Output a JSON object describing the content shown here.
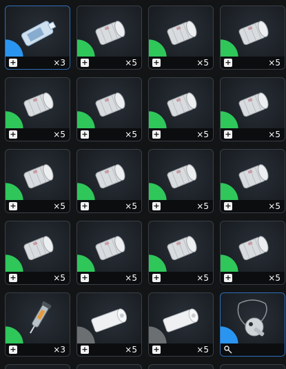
{
  "inventory": {
    "rows": [
      [
        {
          "item": "blood-bag",
          "quantity": "×3",
          "rarity": "blue",
          "badge": "+"
        },
        {
          "item": "bandage-roll",
          "quantity": "×5",
          "rarity": "green",
          "badge": "+"
        },
        {
          "item": "bandage-roll",
          "quantity": "×5",
          "rarity": "green",
          "badge": "+"
        },
        {
          "item": "bandage-roll",
          "quantity": "×5",
          "rarity": "green",
          "badge": "+"
        }
      ],
      [
        {
          "item": "bandage-roll",
          "quantity": "×5",
          "rarity": "green",
          "badge": "+"
        },
        {
          "item": "bandage-roll",
          "quantity": "×5",
          "rarity": "green",
          "badge": "+"
        },
        {
          "item": "bandage-roll",
          "quantity": "×5",
          "rarity": "green",
          "badge": "+"
        },
        {
          "item": "bandage-roll",
          "quantity": "×5",
          "rarity": "green",
          "badge": "+"
        }
      ],
      [
        {
          "item": "bandage-roll",
          "quantity": "×5",
          "rarity": "green",
          "badge": "+"
        },
        {
          "item": "bandage-roll",
          "quantity": "×5",
          "rarity": "green",
          "badge": "+"
        },
        {
          "item": "bandage-roll",
          "quantity": "×5",
          "rarity": "green",
          "badge": "+"
        },
        {
          "item": "bandage-roll",
          "quantity": "×5",
          "rarity": "green",
          "badge": "+"
        }
      ],
      [
        {
          "item": "bandage-roll",
          "quantity": "×5",
          "rarity": "green",
          "badge": "+"
        },
        {
          "item": "bandage-roll",
          "quantity": "×5",
          "rarity": "green",
          "badge": "+"
        },
        {
          "item": "bandage-roll",
          "quantity": "×5",
          "rarity": "green",
          "badge": "+"
        },
        {
          "item": "bandage-roll",
          "quantity": "×5",
          "rarity": "green",
          "badge": "+"
        }
      ],
      [
        {
          "item": "injector",
          "quantity": "×3",
          "rarity": "green",
          "badge": "+"
        },
        {
          "item": "gauze-bandage",
          "quantity": "×5",
          "rarity": "gray",
          "badge": "+"
        },
        {
          "item": "gauze-bandage",
          "quantity": "×5",
          "rarity": "gray",
          "badge": "+"
        },
        {
          "item": "keycard-on-lanyard",
          "quantity": "",
          "rarity": "blue",
          "badge": "key"
        }
      ]
    ]
  },
  "colors": {
    "green_rarity": "#2fc65a",
    "blue_rarity": "#2a95f0",
    "gray_rarity": "#6b6f72"
  }
}
